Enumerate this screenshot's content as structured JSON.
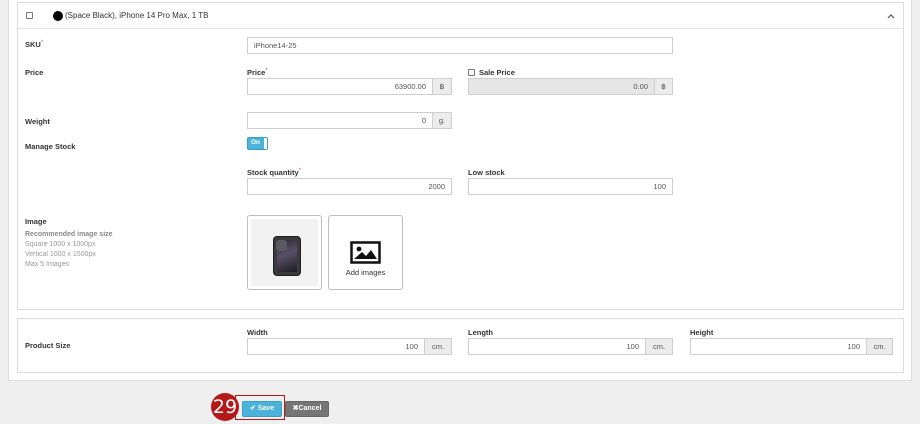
{
  "variant": {
    "title": "(Space Black), iPhone 14 Pro Max, 1 TB",
    "color_swatch": "#000000"
  },
  "sku": {
    "label": "SKU",
    "required": "*",
    "value": "iPhone14-25"
  },
  "price": {
    "section_label": "Price",
    "price_label": "Price",
    "required": "*",
    "price_value": "63900.00",
    "currency": "฿",
    "sale_label": "Sale Price",
    "sale_value": "0.00",
    "sale_currency": "฿"
  },
  "weight": {
    "label": "Weight",
    "value": "0",
    "unit": "g."
  },
  "stock": {
    "manage_label": "Manage Stock",
    "toggle_label": "On",
    "quantity_label": "Stock quantity",
    "required": "*",
    "quantity_value": "2000",
    "low_label": "Low stock",
    "low_value": "100"
  },
  "image": {
    "label": "Image",
    "hint_title": "Recommended image size",
    "hint_lines": [
      "Square 1000 x 1000px",
      "Vertical 1000 x 1500px",
      "Max 5 Images"
    ],
    "add_label": "Add images"
  },
  "product_size": {
    "label": "Product Size",
    "width_label": "Width",
    "width_value": "100",
    "width_unit": "cm.",
    "length_label": "Length",
    "length_value": "100",
    "length_unit": "cm.",
    "height_label": "Height",
    "height_value": "100",
    "height_unit": "cm."
  },
  "actions": {
    "save": "Save",
    "cancel": "Cancel"
  },
  "step_badge": "29",
  "colors": {
    "accent": "#4bb3d9",
    "cancel": "#757575",
    "annotation": "#b41818"
  }
}
